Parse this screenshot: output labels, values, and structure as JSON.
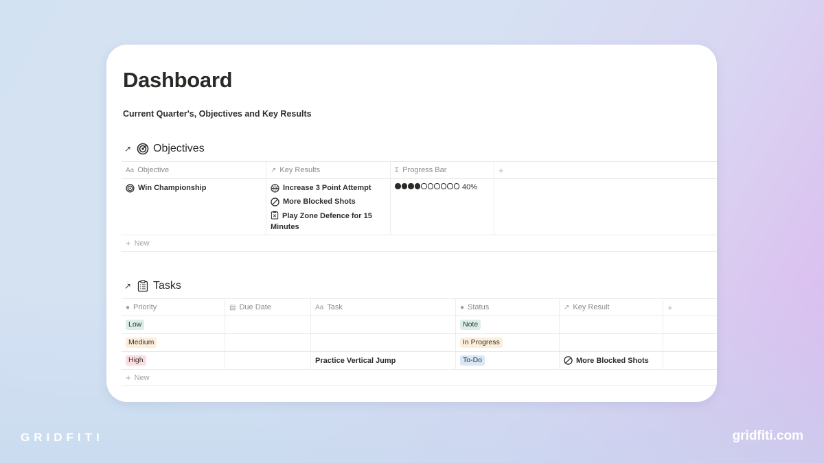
{
  "page": {
    "title": "Dashboard",
    "subtitle": "Current Quarter's, Objectives and Key Results"
  },
  "objectives": {
    "heading": "Objectives",
    "heading_icon": "target-icon",
    "columns": [
      {
        "label": "Objective",
        "icon": "text-icon"
      },
      {
        "label": "Key Results",
        "icon": "relation-arrow-icon"
      },
      {
        "label": "Progress Bar",
        "icon": "sigma-icon"
      }
    ],
    "rows": [
      {
        "objective": "Win Championship",
        "objective_icon": "target-icon",
        "key_results": [
          {
            "label": "Increase 3 Point Attempt",
            "icon": "basketball-icon"
          },
          {
            "label": "More Blocked Shots",
            "icon": "prohibited-icon"
          },
          {
            "label": "Play Zone Defence for 15 Minutes",
            "icon": "clipboard-icon"
          }
        ],
        "progress": {
          "filled": 4,
          "total": 10,
          "percent": 40,
          "label": "40%"
        }
      }
    ],
    "new_label": "New"
  },
  "tasks": {
    "heading": "Tasks",
    "heading_icon": "clipboard-list-icon",
    "columns": [
      {
        "label": "Priority",
        "icon": "select-icon"
      },
      {
        "label": "Due Date",
        "icon": "calendar-icon"
      },
      {
        "label": "Task",
        "icon": "text-icon"
      },
      {
        "label": "Status",
        "icon": "select-icon"
      },
      {
        "label": "Key Result",
        "icon": "relation-arrow-icon"
      }
    ],
    "rows": [
      {
        "priority": "Low",
        "due_date": "",
        "task": "",
        "status": "Note",
        "key_result": ""
      },
      {
        "priority": "Medium",
        "due_date": "",
        "task": "",
        "status": "In Progress",
        "key_result": ""
      },
      {
        "priority": "High",
        "due_date": "",
        "task": "Practice Vertical Jump",
        "status": "To-Do",
        "key_result": "More Blocked Shots"
      }
    ],
    "new_label": "New"
  },
  "tag_colors": {
    "Low": "#dbeee8",
    "Medium": "#fbeedb",
    "High": "#fbdde0",
    "Note": "#dbeee8",
    "In Progress": "#fbeedb",
    "To-Do": "#d9e7f7"
  },
  "watermark": {
    "left": "GRIDFITI",
    "right": "gridfiti.com"
  }
}
